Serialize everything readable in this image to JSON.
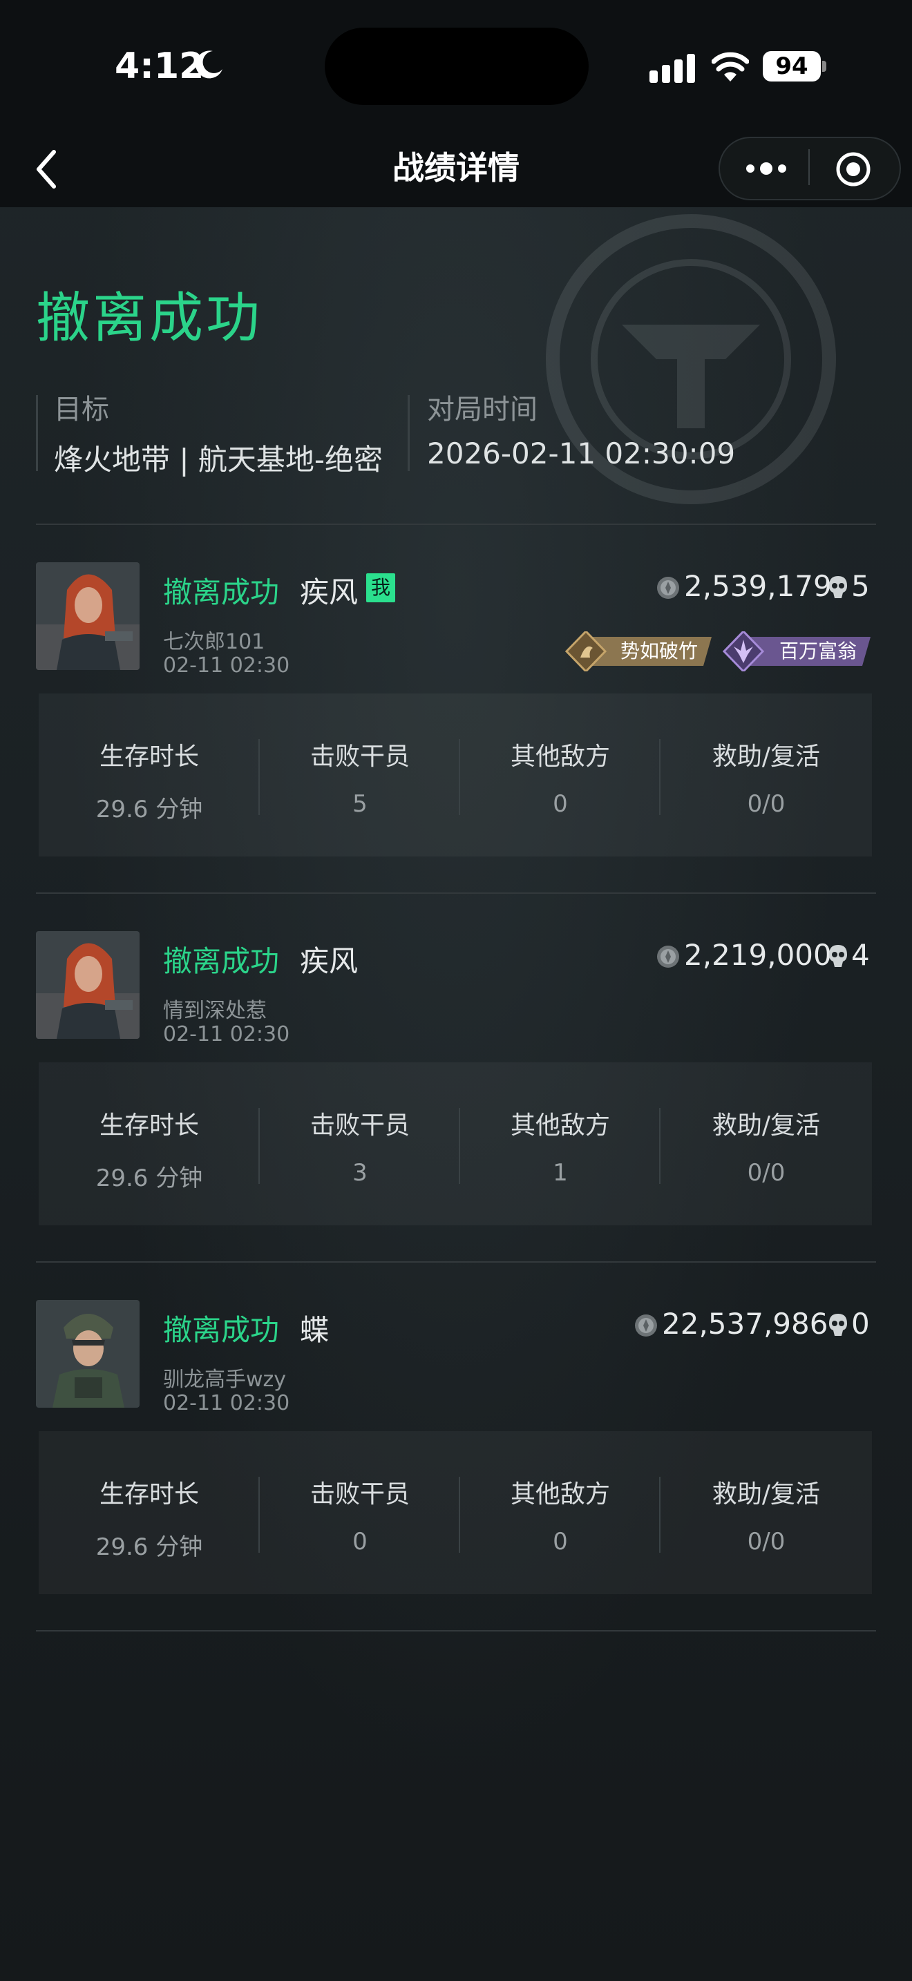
{
  "status_bar": {
    "time": "4:12",
    "battery": "94"
  },
  "nav": {
    "title": "战绩详情"
  },
  "headline": "撤离成功",
  "info": {
    "target_label": "目标",
    "target_value": "烽火地带 | 航天基地-绝密",
    "time_label": "对局时间",
    "time_value": "2026-02-11 02:30:09"
  },
  "stat_labels": [
    "生存时长",
    "击败干员",
    "其他敌方",
    "救助/复活"
  ],
  "me_label": "我",
  "players": [
    {
      "status": "撤离成功",
      "operator": "疾风",
      "name": "七次郎101",
      "time": "02-11 02:30",
      "money": "2,539,179",
      "kills": "5",
      "badges": [
        "势如破竹",
        "百万富翁"
      ],
      "stats": [
        "29.6 分钟",
        "5",
        "0",
        "0/0"
      ]
    },
    {
      "status": "撤离成功",
      "operator": "疾风",
      "name": "情到深处惹",
      "time": "02-11 02:30",
      "money": "2,219,000",
      "kills": "4",
      "stats": [
        "29.6 分钟",
        "3",
        "1",
        "0/0"
      ]
    },
    {
      "status": "撤离成功",
      "operator": "蝶",
      "name": "驯龙高手wzy",
      "time": "02-11 02:30",
      "money": "22,537,986",
      "kills": "0",
      "stats": [
        "29.6 分钟",
        "0",
        "0",
        "0/0"
      ]
    }
  ],
  "colors": {
    "success": "#2bd48a",
    "me_badge": "#2be08e",
    "badge_gold": "#8c7650",
    "badge_purple": "#6a5690"
  }
}
